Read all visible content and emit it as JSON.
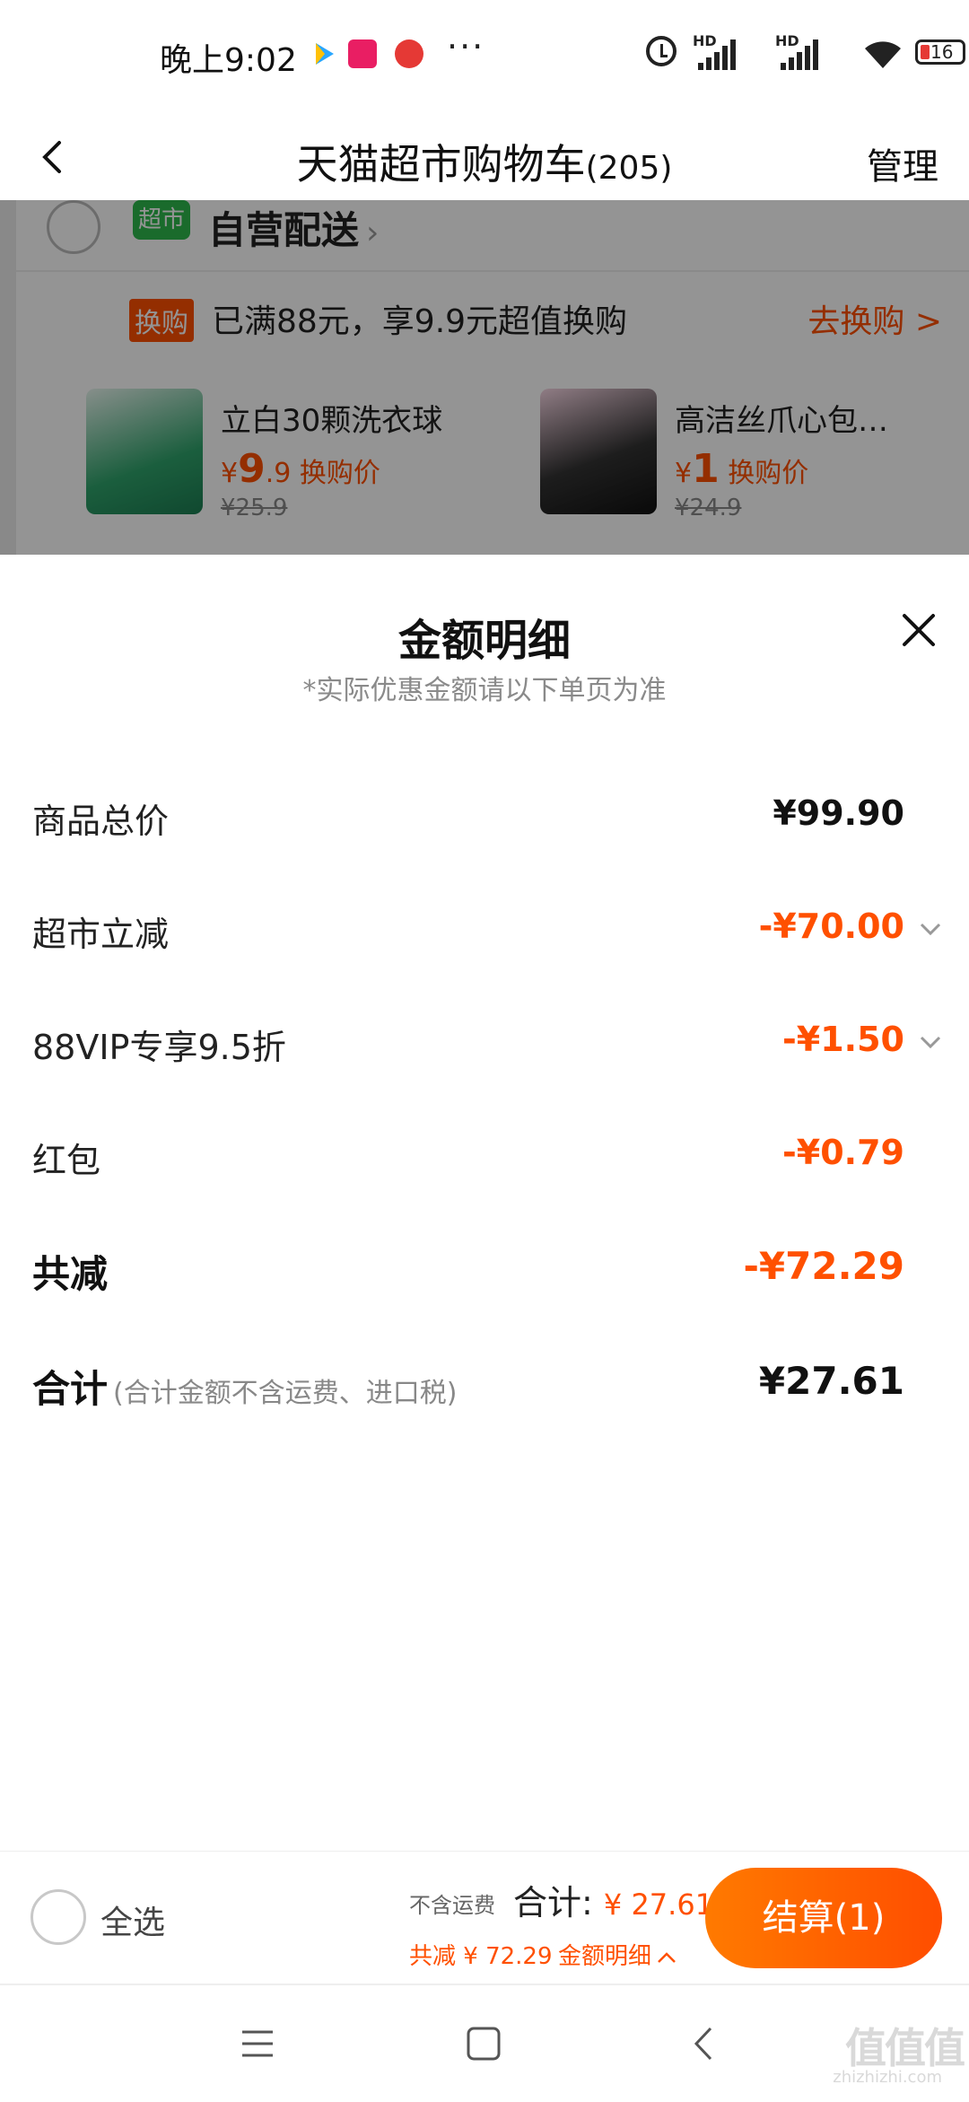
{
  "status": {
    "time": "晚上9:02",
    "hd1": "HD",
    "hd2": "HD",
    "battery": "16",
    "more": "···"
  },
  "header": {
    "title": "天猫超市购物车",
    "count": "(205)",
    "manage": "管理"
  },
  "background": {
    "store_logo": "超市",
    "store_name": "自营配送",
    "huangou_tag": "换购",
    "huangou_text": "已满88元，享9.9元超值换购",
    "huangou_go": "去换购 >",
    "products": [
      {
        "name": "立白30颗洗衣球",
        "price_int": "9",
        "price_dec": ".9",
        "price_label": "换购价",
        "orig": "¥25.9"
      },
      {
        "name": "高洁丝爪心包…",
        "price_int": "1",
        "price_dec": "",
        "price_label": "换购价",
        "orig": "¥24.9"
      }
    ]
  },
  "sheet": {
    "title": "金额明细",
    "subtitle": "*实际优惠金额请以下单页为准",
    "rows": [
      {
        "label": "商品总价",
        "value": "¥99.90"
      },
      {
        "label": "超市立减",
        "value": "-¥70.00"
      },
      {
        "label": "88VIP专享9.5折",
        "value": "-¥1.50"
      },
      {
        "label": "红包",
        "value": "-¥0.79"
      },
      {
        "label": "共减",
        "value": "-¥72.29"
      },
      {
        "label": "合计",
        "note": "(合计金额不含运费、进口税)",
        "value": "¥27.61"
      }
    ]
  },
  "bottom": {
    "select_all": "全选",
    "no_shipping": "不含运费",
    "total_label": "合计:",
    "total_amount": "¥ 27.61",
    "saved": "共减 ¥ 72.29",
    "detail_link": "金额明细",
    "checkout": "结算(1)"
  },
  "watermark": {
    "text": "值值值",
    "sub": "zhizhizhi.com"
  },
  "colors": {
    "accent": "#ff5000",
    "green": "#2db84d"
  }
}
